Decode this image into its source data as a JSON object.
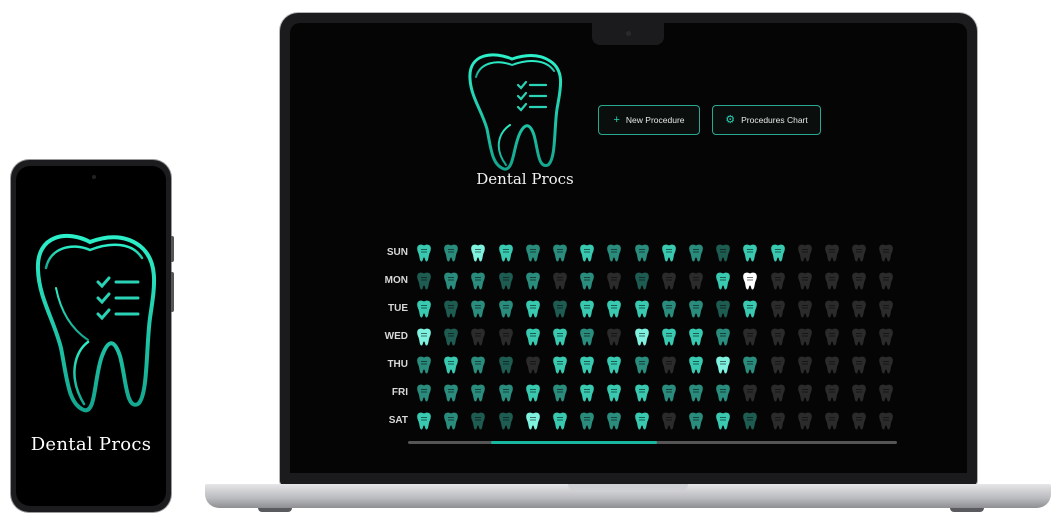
{
  "app": {
    "name": "Dental Procs"
  },
  "phone": {
    "title": "Dental Procs"
  },
  "toolbar": {
    "new_label": "New Procedure",
    "new_icon": "plus-icon",
    "chart_label": "Procedures Chart",
    "chart_icon": "gear-icon"
  },
  "colors": {
    "accent": "#2ad3b6",
    "level_0": "#2b2b2b",
    "level_1": "#1e5c52",
    "level_2": "#2a8c7c",
    "level_3": "#38c9b0",
    "level_4": "#7ff1df",
    "today": "#ffffff"
  },
  "grid": {
    "days": [
      "SUN",
      "MON",
      "TUE",
      "WED",
      "THU",
      "FRI",
      "SAT"
    ],
    "levels": [
      [
        3,
        2,
        4,
        3,
        2,
        2,
        3,
        2,
        2,
        3,
        2,
        1,
        3,
        3,
        0,
        0,
        0,
        0
      ],
      [
        1,
        2,
        2,
        1,
        2,
        0,
        2,
        0,
        1,
        0,
        0,
        3,
        5,
        0,
        0,
        0,
        0,
        0
      ],
      [
        3,
        1,
        2,
        2,
        3,
        1,
        3,
        3,
        3,
        2,
        2,
        1,
        3,
        0,
        0,
        0,
        0,
        0
      ],
      [
        4,
        1,
        0,
        0,
        3,
        3,
        2,
        0,
        4,
        3,
        3,
        2,
        0,
        0,
        0,
        0,
        0,
        0
      ],
      [
        2,
        3,
        2,
        1,
        0,
        3,
        3,
        3,
        2,
        0,
        3,
        4,
        2,
        0,
        0,
        0,
        0,
        0
      ],
      [
        2,
        2,
        2,
        2,
        3,
        2,
        3,
        3,
        3,
        2,
        2,
        2,
        0,
        0,
        0,
        0,
        0,
        0
      ],
      [
        3,
        2,
        1,
        1,
        4,
        3,
        2,
        2,
        3,
        0,
        2,
        3,
        1,
        0,
        0,
        0,
        0,
        0
      ]
    ]
  },
  "scrollbar": {
    "position": 0.17,
    "visible_fraction": 0.34
  }
}
